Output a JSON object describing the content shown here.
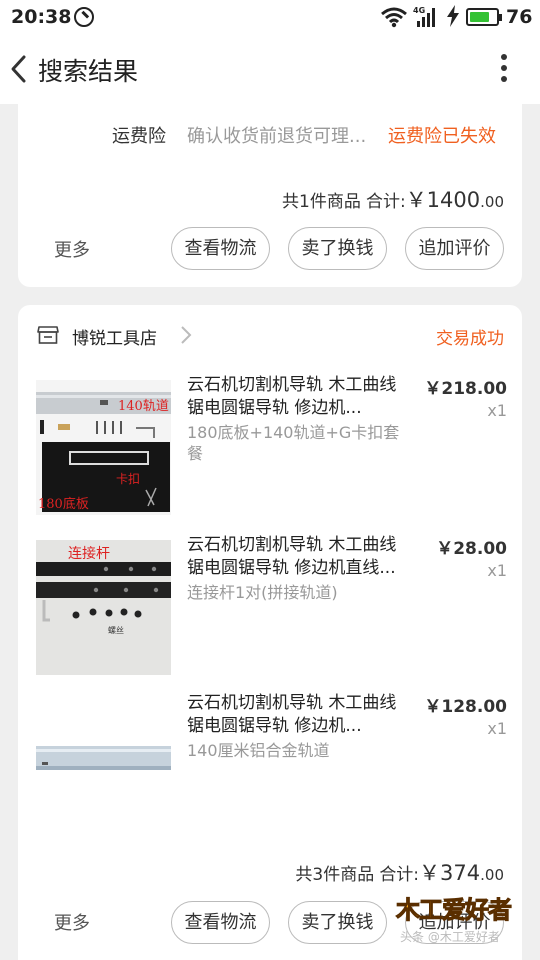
{
  "status_bar": {
    "time": "20:38",
    "network": "4G",
    "battery_level": "76",
    "battery_fraction": 0.76
  },
  "nav": {
    "title": "搜索结果"
  },
  "order_prev": {
    "insurance_label": "运费险",
    "insurance_desc": "确认收货前退货可理...",
    "insurance_status": "运费险已失效",
    "count_text": "共1件商品",
    "total_label": "合计:",
    "total_amount": "￥1400",
    "total_decimal": ".00",
    "more": "更多",
    "buttons": [
      "查看物流",
      "卖了换钱",
      "追加评价"
    ]
  },
  "order": {
    "shop_name": "博锐工具店",
    "status": "交易成功",
    "items": [
      {
        "title": "云石机切割机导轨 木工曲线锯电圆锯导轨 修边机...",
        "sku": "180底板+140轨道+G卡扣套餐",
        "price": "￥218.00",
        "qty": "x1",
        "thumb_labels": [
          "140轨道",
          "卡扣",
          "180底板"
        ]
      },
      {
        "title": "云石机切割机导轨 木工曲线锯电圆锯导轨 修边机直线...",
        "sku": "连接杆1对(拼接轨道)",
        "price": "￥28.00",
        "qty": "x1",
        "thumb_labels": [
          "连接杆",
          "螺丝"
        ]
      },
      {
        "title": "云石机切割机导轨 木工曲线锯电圆锯导轨 修边机...",
        "sku": "140厘米铝合金轨道",
        "price": "￥128.00",
        "qty": "x1"
      }
    ],
    "count_text": "共3件商品",
    "total_label": "合计:",
    "total_amount": "￥374",
    "total_decimal": ".00",
    "more": "更多",
    "buttons": [
      "查看物流",
      "卖了换钱",
      "追加评价"
    ]
  },
  "watermark": {
    "text": "木工爱好者",
    "sub": "头条 @木工爱好者"
  },
  "colors": {
    "accent": "#f06020",
    "battery": "#34c234"
  }
}
